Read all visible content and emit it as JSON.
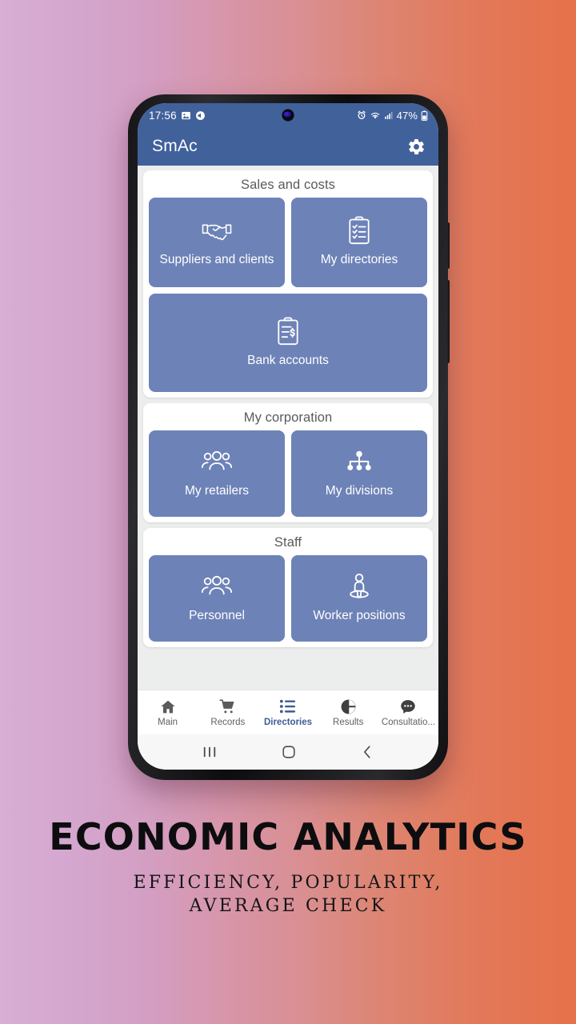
{
  "status_bar": {
    "time": "17:56",
    "battery_percent": "47%",
    "icons": [
      "image-icon",
      "volume-icon",
      "alarm-icon",
      "wifi-icon",
      "cellular-signal-icon",
      "battery-icon"
    ]
  },
  "app_bar": {
    "title": "SmAc",
    "settings_icon": "gear-icon"
  },
  "sections": [
    {
      "title": "Sales and costs",
      "rows": [
        [
          {
            "label": "Suppliers and clients",
            "icon": "handshake-icon"
          },
          {
            "label": "My directories",
            "icon": "clipboard-checklist-icon"
          }
        ],
        [
          {
            "label": "Bank accounts",
            "icon": "clipboard-dollar-icon"
          }
        ]
      ]
    },
    {
      "title": "My corporation",
      "rows": [
        [
          {
            "label": "My retailers",
            "icon": "people-group-icon"
          },
          {
            "label": "My divisions",
            "icon": "org-chart-icon"
          }
        ]
      ]
    },
    {
      "title": "Staff",
      "rows": [
        [
          {
            "label": "Personnel",
            "icon": "people-group-icon"
          },
          {
            "label": "Worker positions",
            "icon": "person-position-icon"
          }
        ]
      ]
    }
  ],
  "bottom_nav": [
    {
      "label": "Main",
      "icon": "home-icon",
      "active": false
    },
    {
      "label": "Records",
      "icon": "shopping-cart-icon",
      "active": false
    },
    {
      "label": "Directories",
      "icon": "list-icon",
      "active": true
    },
    {
      "label": "Results",
      "icon": "pie-chart-icon",
      "active": false
    },
    {
      "label": "Consultatio...",
      "icon": "chat-bubble-icon",
      "active": false
    }
  ],
  "system_bar": [
    {
      "name": "recents-button",
      "icon": "recents-icon"
    },
    {
      "name": "home-button",
      "icon": "home-square-icon"
    },
    {
      "name": "back-button",
      "icon": "back-chevron-icon"
    }
  ],
  "caption": {
    "title": "ECONOMIC ANALYTICS",
    "subtitle_line1": "EFFICIENCY, POPULARITY,",
    "subtitle_line2": "AVERAGE CHECK"
  },
  "colors": {
    "app_bar": "#41619b",
    "tile": "#6d82b7",
    "content_bg": "#eceded",
    "active_nav": "#3c5b96",
    "gradient_start": "#d8aed4",
    "gradient_end": "#e6714a"
  }
}
